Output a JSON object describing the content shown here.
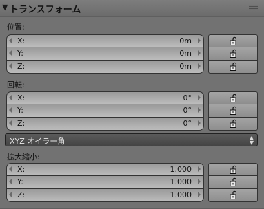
{
  "panel": {
    "title": "トランスフォーム",
    "collapse_icon": "triangle-down-icon",
    "drag_icon": "drag-grip-icon"
  },
  "location": {
    "label": "位置:",
    "fields": [
      {
        "axis": "X:",
        "value": "0m"
      },
      {
        "axis": "Y:",
        "value": "0m"
      },
      {
        "axis": "Z:",
        "value": "0m"
      }
    ]
  },
  "rotation": {
    "label": "回転:",
    "fields": [
      {
        "axis": "X:",
        "value": "0°"
      },
      {
        "axis": "Y:",
        "value": "0°"
      },
      {
        "axis": "Z:",
        "value": "0°"
      }
    ],
    "mode": "XYZ オイラー角"
  },
  "scale": {
    "label": "拡大縮小:",
    "fields": [
      {
        "axis": "X:",
        "value": "1.000"
      },
      {
        "axis": "Y:",
        "value": "1.000"
      },
      {
        "axis": "Z:",
        "value": "1.000"
      }
    ]
  },
  "lock_icon": "unlocked-padlock-icon",
  "colors": {
    "panel_bg": "#727272",
    "field_bg": "#b0b0b0",
    "dropdown_bg": "#4e4e4e"
  }
}
